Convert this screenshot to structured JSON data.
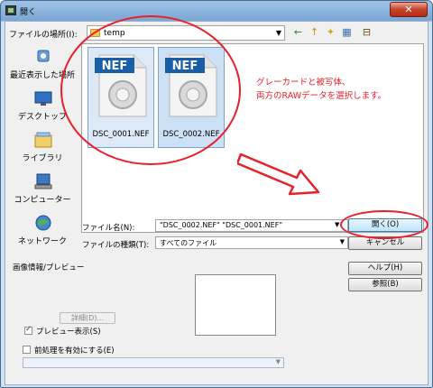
{
  "window": {
    "title": "開く",
    "close_symbol": "✕"
  },
  "lookin": {
    "label": "ファイルの場所(I):",
    "value": "temp"
  },
  "toolbar": {
    "back_icon": "←",
    "up_icon": "↑",
    "newfolder_icon": "✦",
    "views_icon": "▦"
  },
  "places": [
    {
      "label": "最近表示した場所"
    },
    {
      "label": "デスクトップ"
    },
    {
      "label": "ライブラリ"
    },
    {
      "label": "コンピューター"
    },
    {
      "label": "ネットワーク"
    }
  ],
  "files": [
    {
      "name": "DSC_0001.NEF",
      "badge": "NEF"
    },
    {
      "name": "DSC_0002.NEF",
      "badge": "NEF"
    }
  ],
  "annotation": {
    "line1": "グレーカードと被写体、",
    "line2": "両方のRAWデータを選択します。"
  },
  "filename": {
    "label": "ファイル名(N):",
    "value": "\"DSC_0002.NEF\" \"DSC_0001.NEF\""
  },
  "filetype": {
    "label": "ファイルの種類(T):",
    "value": "すべてのファイル"
  },
  "buttons": {
    "open": "開く(O)",
    "cancel": "キャンセル",
    "help": "ヘルプ(H)",
    "browse": "参照(B)",
    "detail": "詳細(D)..."
  },
  "preview": {
    "group_label": "画像情報/プレビュー",
    "show_label": "プレビュー表示(S)",
    "show_checked": true
  },
  "preprocess": {
    "label": "前処理を有効にする(E)",
    "checked": false
  },
  "colors": {
    "accent_red": "#e8202a",
    "nef_blue": "#1a5ea8"
  }
}
